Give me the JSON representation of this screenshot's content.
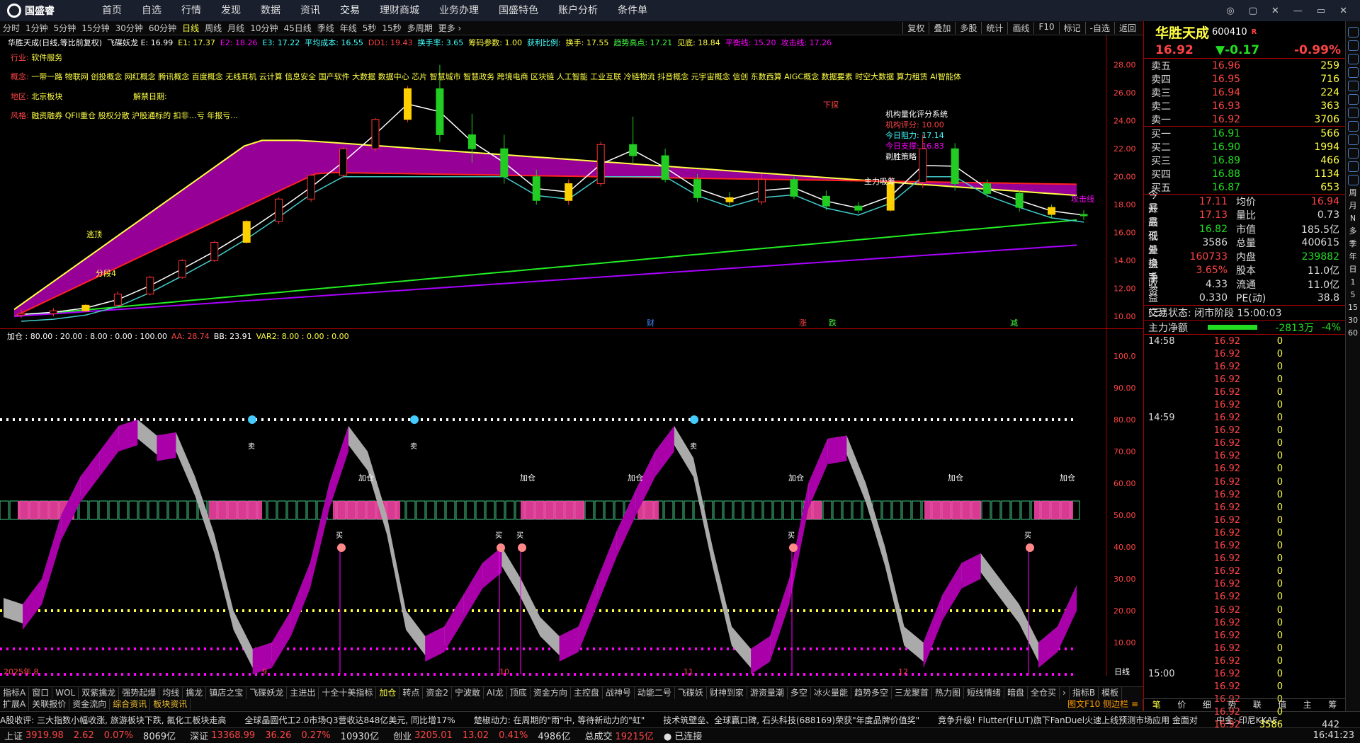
{
  "app": {
    "logo": "国盛睿",
    "nav": [
      "首页",
      "自选",
      "行情",
      "发现",
      "数据",
      "资讯",
      "交易",
      "理财商城",
      "业务办理",
      "国盛特色",
      "账户分析",
      "条件单"
    ],
    "window_buttons": [
      "◎",
      "▢",
      "✕",
      "—",
      "▭",
      "✕"
    ]
  },
  "timeframes": [
    "分时",
    "1分钟",
    "5分钟",
    "15分钟",
    "30分钟",
    "60分钟",
    "日线",
    "周线",
    "月线",
    "10分钟",
    "45日线",
    "季线",
    "年线",
    "5秒",
    "15秒",
    "多周期",
    "更多 ›"
  ],
  "right_tools": [
    "复权",
    "叠加",
    "多股",
    "统计",
    "画线",
    "F10",
    "标记",
    "-自选",
    "返回"
  ],
  "info_line": [
    {
      "t": "华胜天成(日线,等比前复权)",
      "c": "#fff"
    },
    {
      "t": "飞碟妖龙 E: 16.99",
      "c": "#fff"
    },
    {
      "t": "E1: 17.37",
      "c": "#ff4"
    },
    {
      "t": "E2: 18.26",
      "c": "#f0f"
    },
    {
      "t": "E3: 17.22",
      "c": "#4ff"
    },
    {
      "t": "平均成本: 16.55",
      "c": "#4ff"
    },
    {
      "t": "DD1: 19.43",
      "c": "#f44"
    },
    {
      "t": "换手率: 3.65",
      "c": "#4ff"
    },
    {
      "t": "筹码参数: 1.00",
      "c": "#ff4"
    },
    {
      "t": "获利比例:",
      "c": "#4ff"
    },
    {
      "t": "换手: 17.55",
      "c": "#ff4"
    },
    {
      "t": "趋势高点: 17.21",
      "c": "#4f4"
    },
    {
      "t": "见底: 18.84",
      "c": "#ff4"
    },
    {
      "t": "平衡线: 15.20",
      "c": "#f0f"
    },
    {
      "t": "攻击线: 17.26",
      "c": "#f0f"
    }
  ],
  "overlay": {
    "industry": "行业: 软件服务",
    "concept": "概念: 一带一路 物联网 创投概念 网红概念 腾讯概念 百度概念 无线耳机 云计算 信息安全 国产软件 大数据 数据中心 芯片 智慧城市 智慧政务 跨境电商 区块链 人工智能 工业互联 冷链物流 抖音概念 元宇宙概念 信创 东数西算 AIGC概念 数据要素 时空大数据 算力租赁 AI智能体",
    "region": "地区: 北京板块",
    "unlock": "解禁日期:",
    "style": "风格: 融资融券 QFII重仓 股权分散 沪股通标的 扣非…亏 年报亏…"
  },
  "rating": {
    "title": "机构量化评分系统",
    "items": [
      {
        "t": "机构评分: 10.00",
        "c": "#f44"
      },
      {
        "t": "今日阻力: 17.14",
        "c": "#4ff"
      },
      {
        "t": "今日支撑: 16.83",
        "c": "#f0f"
      },
      {
        "t": "剃胜策略",
        "c": "#fff"
      }
    ]
  },
  "chart_labels": [
    "主力吸筹",
    "攻击线",
    "下探",
    "涨",
    "跌",
    "财",
    "减",
    "分段4",
    "逃顶"
  ],
  "price_axis": [
    "28.00",
    "26.00",
    "24.00",
    "22.00",
    "20.00",
    "18.00",
    "16.00",
    "14.00",
    "12.00",
    "10.00"
  ],
  "ind_axis": [
    "100.0",
    "90.00",
    "80.00",
    "70.00",
    "60.00",
    "50.00",
    "40.00",
    "30.00",
    "20.00",
    "10.00"
  ],
  "ind_line": [
    {
      "t": "加仓 : 80.00 : 20.00 : 8.00 : 0.00 : 100.00",
      "c": "#fff"
    },
    {
      "t": "AA: 28.74",
      "c": "#f44"
    },
    {
      "t": "BB: 23.91",
      "c": "#fff"
    },
    {
      "t": "VAR2: 8.00 : 0.00 : 0.00",
      "c": "#ff4"
    }
  ],
  "signals": {
    "add": "加仓",
    "buy": "买",
    "sell": "卖"
  },
  "months": [
    "2025年 8",
    "9",
    "10",
    "11",
    "12"
  ],
  "day_label": "日线",
  "bottom_tabs1": [
    "指标A",
    "窗口",
    "WOL",
    "双紫擒龙",
    "强势起爆",
    "均线",
    "擒龙",
    "镇店之宝",
    "飞碟妖龙",
    "主进出",
    "十全十美指标",
    "加仓",
    "转点",
    "资金2",
    "宁波敢",
    "AI龙",
    "顶底",
    "资金方向",
    "主控盘",
    "战神号",
    "动能二号",
    "飞碟妖",
    "财神到家",
    "游资量潮",
    "多空",
    "冰火量能",
    "趋势多空",
    "三龙聚首",
    "热力图",
    "短线情绪",
    "暗盘",
    "全仓买",
    "›",
    "指标B",
    "模板"
  ],
  "bottom_tabs2": [
    "扩展A",
    "关联报价",
    "资金流向",
    "综合资讯",
    "板块资讯"
  ],
  "bottom_right": "图文F10 侧边栏 ≡",
  "news": [
    "A股收评: 三大指数小幅收涨, 旅游板块下跌, 氟化工板块走高",
    "全球晶圆代工2.0市场Q3营收达848亿美元, 同比增17%",
    "楚椒动力: 在周期的\"雨\"中, 等待新动力的\"虹\"",
    "技术筑壁垒、全球赢口碑, 石头科技(688169)荣获\"年度品牌价值奖\"",
    "竞争升级! Flutter(FLUT)旗下FanDuel火速上线预测市场应用 金面对",
    "中金: 印尼KKAE"
  ],
  "status": {
    "sh": "上证",
    "sh_v": "3919.98",
    "sh_c": "2.62",
    "sh_p": "0.07%",
    "sh_a": "8069亿",
    "sz": "深证",
    "sz_v": "13368.99",
    "sz_c": "36.26",
    "sz_p": "0.27%",
    "sz_a": "10930亿",
    "cy": "创业",
    "cy_v": "3205.01",
    "cy_c": "13.02",
    "cy_p": "0.41%",
    "cy_a": "4986亿",
    "tot": "总成交",
    "tot_v": "19215亿",
    "conn": "已连接",
    "time": "16:41:23"
  },
  "quote": {
    "name": "华胜天成",
    "code": "600410",
    "tag": "R",
    "price": "16.92",
    "change": "▼-0.17",
    "pct": "-0.99%",
    "asks": [
      {
        "n": "卖五",
        "p": "16.96",
        "v": "259"
      },
      {
        "n": "卖四",
        "p": "16.95",
        "v": "716"
      },
      {
        "n": "卖三",
        "p": "16.94",
        "v": "224"
      },
      {
        "n": "卖二",
        "p": "16.93",
        "v": "363"
      },
      {
        "n": "卖一",
        "p": "16.92",
        "v": "3706"
      }
    ],
    "bids": [
      {
        "n": "买一",
        "p": "16.91",
        "v": "566"
      },
      {
        "n": "买二",
        "p": "16.90",
        "v": "1994"
      },
      {
        "n": "买三",
        "p": "16.89",
        "v": "466"
      },
      {
        "n": "买四",
        "p": "16.88",
        "v": "1134"
      },
      {
        "n": "买五",
        "p": "16.87",
        "v": "653"
      }
    ],
    "stats": [
      [
        "今开",
        "17.11",
        "均价",
        "16.94"
      ],
      [
        "最高",
        "17.13",
        "量比",
        "0.73"
      ],
      [
        "最低",
        "16.82",
        "市值",
        "185.5亿"
      ],
      [
        "现量",
        "3586",
        "总量",
        "400615"
      ],
      [
        "外盘",
        "160733",
        "内盘",
        "239882"
      ],
      [
        "换手",
        "3.65%",
        "股本",
        "11.0亿"
      ],
      [
        "净资",
        "4.33",
        "流通",
        "11.0亿"
      ],
      [
        "收益(三)",
        "0.330",
        "PE(动)",
        "38.8"
      ]
    ],
    "trade_status": "交易状态: 闭市阶段 15:00:03",
    "netflow_label": "主力净额",
    "netflow_value": "-2813万",
    "netflow_pct": "-4%",
    "ticks_time1": "14:58",
    "ticks_time2": "14:59",
    "ticks_time3": "15:00",
    "tick_price": "16.92",
    "tick_vol": "0",
    "last_vol": "3586",
    "last_n": "442",
    "tabs": [
      "笔",
      "价",
      "细",
      "势",
      "联",
      "值",
      "主",
      "筹"
    ]
  },
  "side_bar": [
    "周",
    "月",
    "N",
    "多",
    "季",
    "年",
    "日",
    "1",
    "5",
    "15",
    "30",
    "60"
  ],
  "chart_data": {
    "type": "candlestick",
    "title": "华胜天成(日线,等比前复权)",
    "x_range": [
      "2025-07-28",
      "2025-12-30"
    ],
    "y_range": [
      9.5,
      29
    ],
    "ohlc_approx": [
      [
        10.1,
        10.5,
        9.9,
        10.2
      ],
      [
        10.2,
        10.6,
        10.0,
        10.4
      ],
      [
        10.4,
        10.9,
        10.3,
        10.8
      ],
      [
        10.8,
        11.8,
        10.7,
        11.6
      ],
      [
        11.6,
        12.9,
        11.5,
        12.8
      ],
      [
        12.8,
        14.1,
        12.7,
        14.0
      ],
      [
        14.0,
        15.4,
        13.9,
        15.3
      ],
      [
        15.3,
        16.9,
        15.2,
        16.8
      ],
      [
        16.8,
        18.5,
        16.6,
        18.4
      ],
      [
        18.4,
        20.2,
        18.2,
        20.1
      ],
      [
        20.1,
        22.1,
        19.9,
        22.0
      ],
      [
        22.0,
        24.2,
        21.8,
        24.1
      ],
      [
        24.1,
        26.5,
        23.9,
        26.3
      ],
      [
        26.3,
        28.0,
        22.5,
        23.0
      ],
      [
        23.0,
        24.5,
        21.0,
        22.0
      ],
      [
        22.0,
        23.0,
        19.5,
        20.0
      ],
      [
        20.0,
        20.5,
        18.0,
        18.3
      ],
      [
        18.3,
        19.8,
        18.0,
        19.5
      ],
      [
        19.5,
        22.5,
        19.3,
        22.3
      ],
      [
        22.3,
        24.3,
        21.0,
        21.5
      ],
      [
        21.5,
        22.0,
        19.6,
        19.8
      ],
      [
        19.8,
        20.2,
        18.2,
        18.5
      ],
      [
        18.5,
        18.9,
        17.9,
        18.2
      ],
      [
        18.2,
        20.2,
        18.0,
        19.8
      ],
      [
        19.8,
        20.0,
        18.4,
        18.6
      ],
      [
        18.6,
        19.0,
        17.6,
        17.9
      ],
      [
        17.9,
        18.2,
        17.4,
        17.6
      ],
      [
        17.6,
        20.0,
        17.5,
        19.6
      ],
      [
        19.6,
        23.0,
        19.2,
        22.0
      ],
      [
        22.0,
        22.4,
        19.0,
        19.5
      ],
      [
        19.5,
        19.8,
        18.5,
        18.8
      ],
      [
        18.8,
        19.0,
        17.5,
        17.8
      ],
      [
        17.8,
        18.0,
        17.0,
        17.3
      ],
      [
        17.3,
        17.6,
        16.9,
        17.2
      ]
    ],
    "series": [
      {
        "name": "E1",
        "color": "#ffff44"
      },
      {
        "name": "E2",
        "color": "#ff00ff"
      },
      {
        "name": "E3",
        "color": "#44ffff"
      }
    ]
  }
}
